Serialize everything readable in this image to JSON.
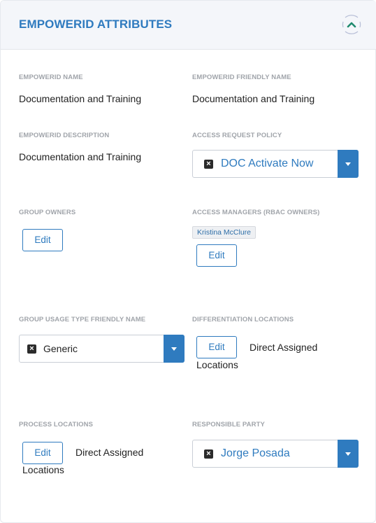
{
  "header": {
    "title": "EMPOWERID ATTRIBUTES"
  },
  "fields": {
    "name": {
      "label": "EMPOWERID NAME",
      "value": "Documentation and Training"
    },
    "friendly_name": {
      "label": "EMPOWERID FRIENDLY NAME",
      "value": "Documentation and Training"
    },
    "description": {
      "label": "EMPOWERID DESCRIPTION",
      "value": "Documentation and Training"
    },
    "access_request_policy": {
      "label": "ACCESS REQUEST POLICY",
      "selected": "DOC Activate Now"
    },
    "group_owners": {
      "label": "GROUP OWNERS",
      "edit_label": "Edit"
    },
    "access_managers": {
      "label": "ACCESS MANAGERS (RBAC OWNERS)",
      "chip": "Kristina McClure",
      "edit_label": "Edit"
    },
    "usage_type": {
      "label": "GROUP USAGE TYPE FRIENDLY NAME",
      "selected": "Generic"
    },
    "differentiation_locations": {
      "label": "DIFFERENTIATION LOCATIONS",
      "edit_label": "Edit",
      "text_line1": "Direct Assigned",
      "text_line2": "Locations"
    },
    "process_locations": {
      "label": "PROCESS LOCATIONS",
      "edit_label": "Edit",
      "text_line1": "Direct Assigned",
      "text_line2": "Locations"
    },
    "responsible_party": {
      "label": "RESPONSIBLE PARTY",
      "selected": "Jorge Posada"
    }
  },
  "icons": {
    "collapse": "chevron-up-icon",
    "clear": "close-icon",
    "dropdown": "caret-down-icon"
  },
  "colors": {
    "accent": "#2f7bbf",
    "header_bg": "#f4f6fa",
    "label": "#a0a4aa"
  }
}
